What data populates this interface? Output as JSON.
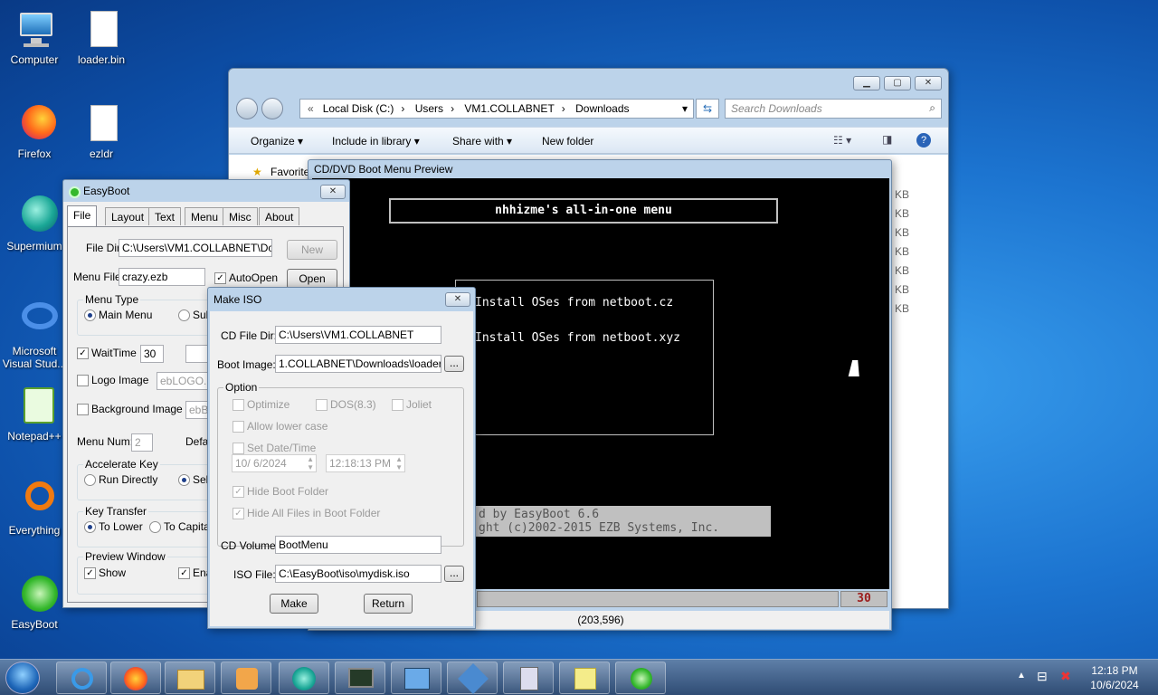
{
  "desktop_icons": [
    {
      "label": "Computer"
    },
    {
      "label": "loader.bin"
    },
    {
      "label": "Firefox"
    },
    {
      "label": "ezldr"
    },
    {
      "label": "Supermium"
    },
    {
      "label": "Microsoft Visual Stud..."
    },
    {
      "label": "Notepad++"
    },
    {
      "label": "Everything"
    },
    {
      "label": "EasyBoot"
    }
  ],
  "explorer": {
    "breadcrumb": [
      "Local Disk (C:)",
      "Users",
      "VM1.COLLABNET",
      "Downloads"
    ],
    "search_placeholder": "Search Downloads",
    "toolbar": {
      "organize": "Organize",
      "include": "Include in library",
      "share": "Share with",
      "new_folder": "New folder"
    },
    "nav_favorites": "Favorites",
    "sizes": [
      "KB",
      "KB",
      "KB",
      "KB",
      "KB",
      "KB",
      "KB"
    ]
  },
  "easyboot": {
    "title": "EasyBoot",
    "tabs": [
      "File",
      "Layout",
      "Text",
      "Menu",
      "Misc",
      "About"
    ],
    "file_dir_label": "File Dir:",
    "file_dir_value": "C:\\Users\\VM1.COLLABNET\\Down",
    "new_btn": "New",
    "menu_file_label": "Menu File:",
    "menu_file_value": "crazy.ezb",
    "autoopen": "AutoOpen",
    "open_btn": "Open",
    "menu_type_title": "Menu Type",
    "main_menu": "Main Menu",
    "sub": "Sub",
    "waittime": "WaitTime",
    "waittime_value": "30",
    "logo_image": "Logo Image",
    "logo_value": "ebLOGO.BI",
    "bg_image": "Background Image",
    "bg_value": "ebBA",
    "menu_num": "Menu Num:",
    "menu_num_value": "2",
    "default": "Defa",
    "accel_title": "Accelerate Key",
    "run_directly": "Run Directly",
    "sel": "Sel",
    "key_transfer_title": "Key Transfer",
    "to_lower": "To Lower",
    "to_capital": "To Capital",
    "preview_title": "Preview Window",
    "show": "Show",
    "ena": "Ena"
  },
  "preview": {
    "title": "CD/DVD Boot Menu Preview",
    "menu_title": "nhhizme's all-in-one menu",
    "items": [
      "Install OSes from netboot.cz",
      "Install OSes from netboot.xyz"
    ],
    "footer1": "d by EasyBoot 6.6",
    "footer2": "ght (c)2002-2015 EZB Systems, Inc.",
    "countdown": "30",
    "coords": "(203,596)"
  },
  "makeiso": {
    "title": "Make ISO",
    "cd_file_dir_label": "CD File Dir:",
    "cd_file_dir": "C:\\Users\\VM1.COLLABNET",
    "boot_image_label": "Boot Image:",
    "boot_image": "1.COLLABNET\\Downloads\\loader.bin",
    "browse": "...",
    "option_title": "Option",
    "optimize": "Optimize",
    "dos83": "DOS(8.3)",
    "joliet": "Joliet",
    "allow_lower": "Allow lower case",
    "set_date": "Set Date/Time",
    "date": "10/ 6/2024",
    "time": "12:18:13 PM",
    "hide_boot": "Hide Boot Folder",
    "hide_all": "Hide All Files in Boot Folder",
    "cd_volume_label": "CD Volume:",
    "cd_volume": "BootMenu",
    "iso_file_label": "ISO File:",
    "iso_file": "C:\\EasyBoot\\iso\\mydisk.iso",
    "make_btn": "Make",
    "return_btn": "Return"
  },
  "taskbar": {
    "time": "12:18 PM",
    "date": "10/6/2024"
  },
  "colors": {
    "accent": "#1c74d0",
    "preview_bg": "#000000",
    "countdown": "#9b1c1c"
  }
}
